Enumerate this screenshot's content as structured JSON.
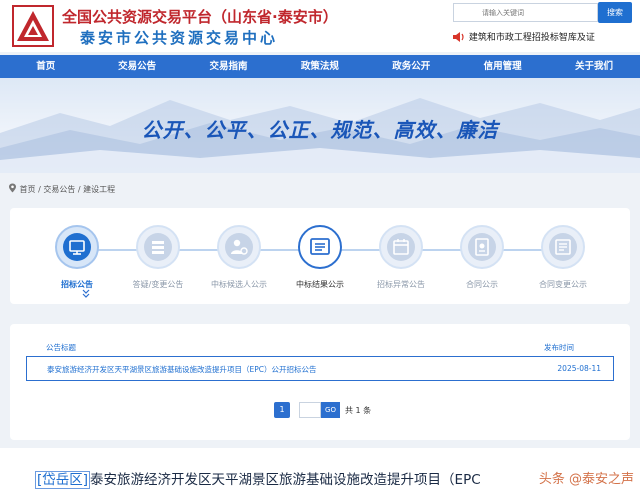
{
  "header": {
    "title_main": "全国公共资源交易平台（山东省·泰安市）",
    "title_sub": "泰安市公共资源交易中心",
    "search_placeholder": "请输入关键词",
    "search_button": "搜索",
    "marquee_text": "建筑和市政工程招投标智库及证"
  },
  "nav": {
    "items": [
      "首页",
      "交易公告",
      "交易指南",
      "政策法规",
      "政务公开",
      "信用管理",
      "关于我们"
    ]
  },
  "banner": {
    "slogan": "公开、公平、公正、规范、高效、廉洁"
  },
  "breadcrumb": {
    "text": "首页 / 交易公告 / 建设工程"
  },
  "steps": [
    {
      "label": "招标公告",
      "icon": "monitor-icon",
      "state": "active"
    },
    {
      "label": "答疑/变更公告",
      "icon": "layers-icon",
      "state": "inactive"
    },
    {
      "label": "中标候选人公示",
      "icon": "person-icon",
      "state": "inactive"
    },
    {
      "label": "中标结果公示",
      "icon": "list-icon",
      "state": "selected"
    },
    {
      "label": "招标异常公告",
      "icon": "calendar-icon",
      "state": "inactive"
    },
    {
      "label": "合同公示",
      "icon": "contract-icon",
      "state": "inactive"
    },
    {
      "label": "合同变更公示",
      "icon": "document-icon",
      "state": "inactive"
    }
  ],
  "table": {
    "headers": {
      "title": "公告标题",
      "date": "发布时间"
    },
    "rows": [
      {
        "title": "泰安旅游经济开发区天平湖景区旅游基础设施改造提升项目（EPC）公开招标公告",
        "date": "2025-08-11"
      }
    ]
  },
  "pagination": {
    "current_page": "1",
    "go_label": "GO",
    "total_text": "共 1 条"
  },
  "bottom": {
    "tag": "[岱岳区]",
    "headline": "泰安旅游经济开发区天平湖景区旅游基础设施改造提升项目（EPC",
    "watermark": "头条 @泰安之声"
  },
  "colors": {
    "primary": "#2c6fcf",
    "title_red": "#c0272d",
    "title_blue": "#1f6fbf"
  }
}
